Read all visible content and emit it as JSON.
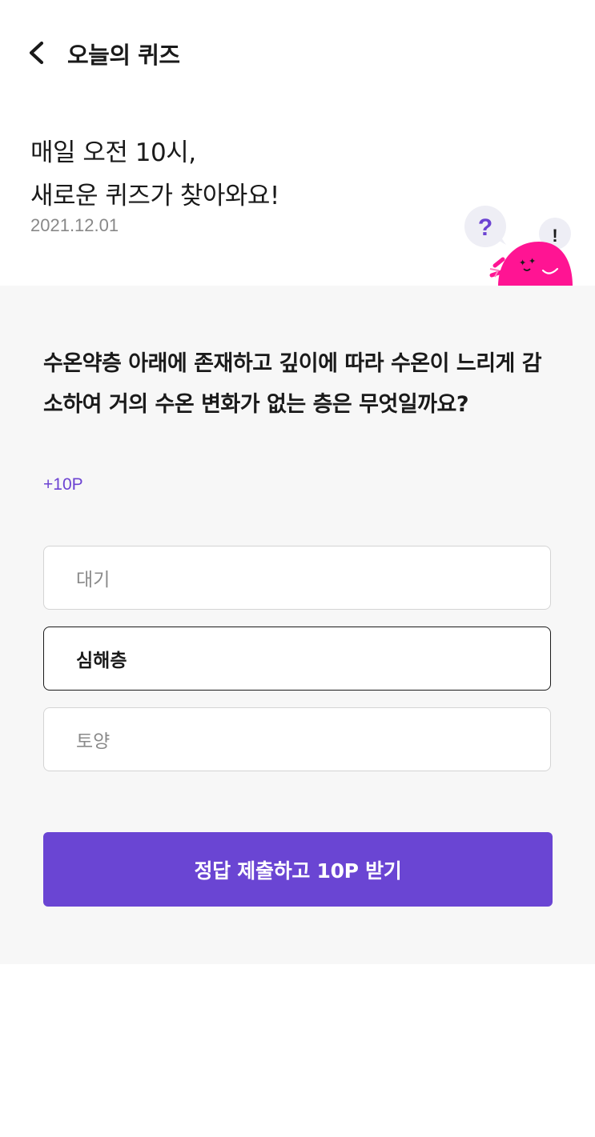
{
  "header": {
    "back_icon": "chevron-left-icon",
    "title": "오늘의 퀴즈"
  },
  "intro": {
    "line1": "매일 오전 10시,",
    "line2": "새로운 퀴즈가 찾아와요!",
    "date": "2021.12.01"
  },
  "mascot": {
    "question_mark": "?",
    "exclamation_mark": "!",
    "body_color": "#ff1493",
    "accent_color": "#6c43d2"
  },
  "quiz": {
    "question": "수온약층 아래에 존재하고 깊이에 따라 수온이 느리게 감소하여 거의 수온 변화가 없는 층은 무엇일까요?",
    "points": "+10P",
    "options": [
      {
        "label": "대기",
        "selected": false
      },
      {
        "label": "심해층",
        "selected": true
      },
      {
        "label": "토양",
        "selected": false
      }
    ],
    "submit_label": "정답 제출하고 10P 받기",
    "submit_color": "#6a45d3"
  }
}
